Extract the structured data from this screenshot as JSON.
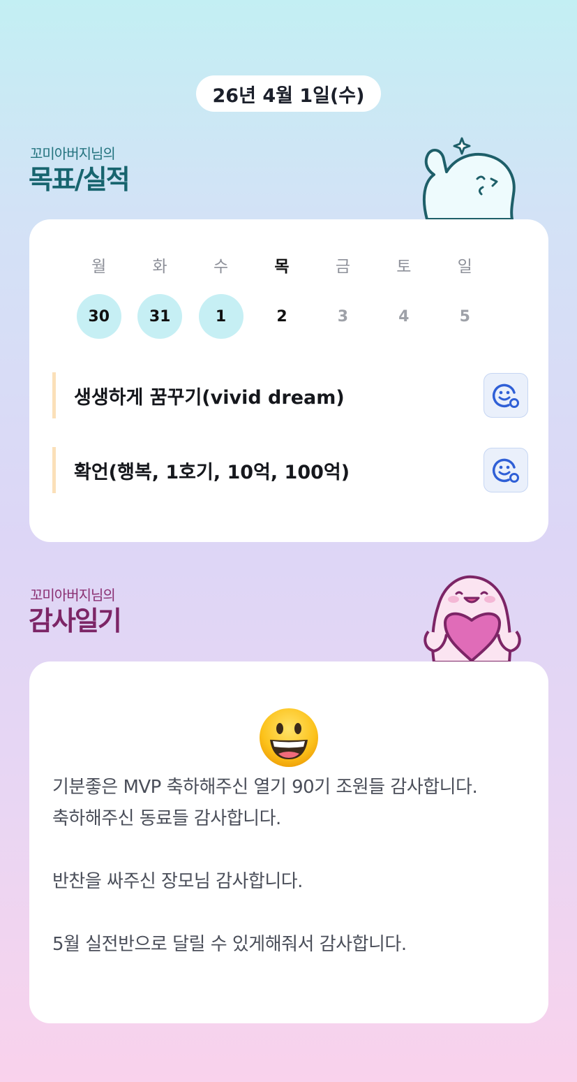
{
  "header": {
    "date": "26년 4월 1일(수)"
  },
  "goals_section": {
    "subtitle": "꼬미아버지님의",
    "title": "목표/실적"
  },
  "week": [
    {
      "day": "월",
      "date": "30",
      "state": "done"
    },
    {
      "day": "화",
      "date": "31",
      "state": "done"
    },
    {
      "day": "수",
      "date": "1",
      "state": "done"
    },
    {
      "day": "목",
      "date": "2",
      "state": "today"
    },
    {
      "day": "금",
      "date": "3",
      "state": "future"
    },
    {
      "day": "토",
      "date": "4",
      "state": "future"
    },
    {
      "day": "일",
      "date": "5",
      "state": "future"
    }
  ],
  "goals": [
    {
      "label": "생생하게 꿈꾸기(vivid dream)",
      "icon": "smiley-add-icon"
    },
    {
      "label": "확언(행복, 1호기, 10억, 100억)",
      "icon": "smiley-add-icon"
    }
  ],
  "gratitude_section": {
    "subtitle": "꼬미아버지님의",
    "title": "감사일기"
  },
  "gratitude": {
    "mood_icon": "grinning-face-icon",
    "lines": [
      "기분좋은 MVP 축하해주신 열기 90기 조원들 감사합니다.",
      "축하해주신 동료들 감사합니다.",
      "",
      "반찬을 싸주신 장모님 감사합니다.",
      "",
      "5월 실전반으로 달릴 수 있게해줘서 감사합니다."
    ]
  },
  "colors": {
    "accent_teal": "#17646e",
    "accent_plum": "#7c2566",
    "done_circle": "#c6eff4",
    "goal_bar": "#fbe0b9",
    "icon_blue": "#2f5fd6"
  }
}
